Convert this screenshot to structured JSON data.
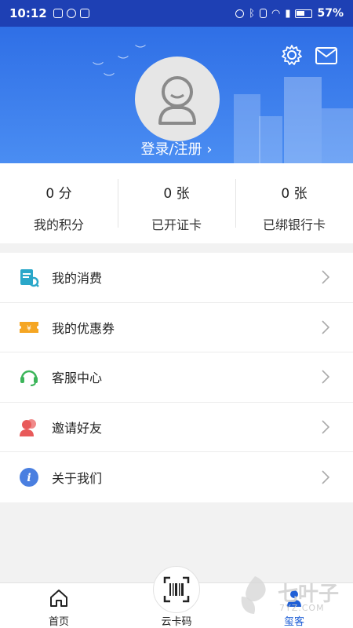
{
  "status_bar": {
    "time": "10:12",
    "battery_pct": "57%",
    "left_icons": [
      "shield-icon",
      "vpn-icon",
      "nfc-icon"
    ],
    "right_icons": [
      "alarm-icon",
      "bluetooth-icon",
      "vibrate-icon",
      "wifi-icon",
      "signal-icon",
      "battery-icon"
    ]
  },
  "header": {
    "login_label": "登录/注册 ›",
    "background_color": "#3b7eee"
  },
  "stats": [
    {
      "value": "0 分",
      "label": "我的积分"
    },
    {
      "value": "0 张",
      "label": "已开证卡"
    },
    {
      "value": "0 张",
      "label": "已绑银行卡"
    }
  ],
  "menu": {
    "items": [
      {
        "label": "我的消费",
        "icon": "receipt-icon",
        "color": "#2aa7c9"
      },
      {
        "label": "我的优惠券",
        "icon": "coupon-icon",
        "color": "#f5a623"
      },
      {
        "label": "客服中心",
        "icon": "headset-icon",
        "color": "#3cb55a"
      },
      {
        "label": "邀请好友",
        "icon": "invite-friends-icon",
        "color": "#e85a5a"
      },
      {
        "label": "关于我们",
        "icon": "info-icon",
        "color": "#4a7fe0"
      }
    ]
  },
  "bottom_nav": {
    "items": [
      {
        "label": "首页",
        "icon": "home-icon"
      },
      {
        "label": "云卡码",
        "icon": "barcode-scan-icon"
      },
      {
        "label": "玺客",
        "icon": "user-icon",
        "active": true
      }
    ],
    "active_color": "#1f5fd6"
  },
  "watermark": {
    "text": "七叶子",
    "sub": "7YZ.COM"
  }
}
